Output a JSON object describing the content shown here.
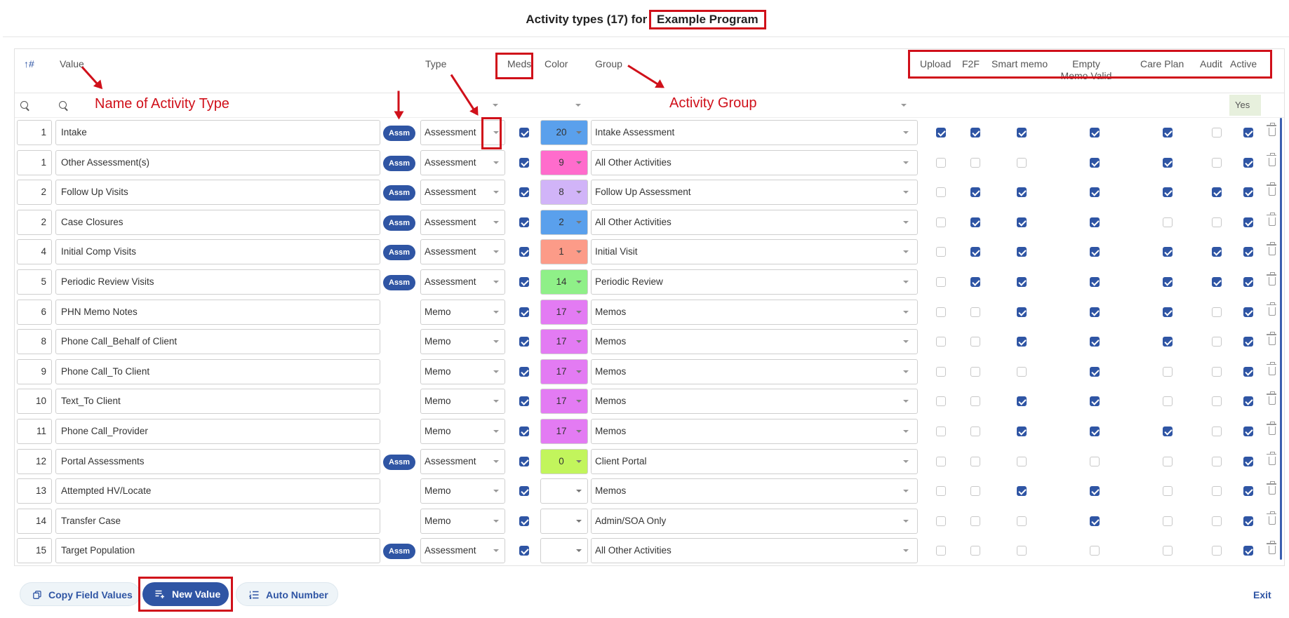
{
  "title": {
    "prefix": "Activity types (17) for",
    "program": "Example Program"
  },
  "columns": {
    "sort": "↑#",
    "value": "Value",
    "type": "Type",
    "meds": "Meds",
    "color": "Color",
    "group": "Group",
    "upload": "Upload",
    "f2f": "F2F",
    "smart_memo": "Smart memo",
    "empty_memo": "Empty Memo Valid",
    "care_plan": "Care Plan",
    "audit": "Audit",
    "active": "Active"
  },
  "filter": {
    "active": "Yes"
  },
  "annotations": {
    "name": "Name of Activity Type",
    "group": "Activity Group"
  },
  "assm_label": "Assm",
  "rows": [
    {
      "num": "1",
      "value": "Intake",
      "assm": true,
      "type": "Assessment",
      "meds": true,
      "color_num": "20",
      "color_hex": "#5aa0ec",
      "group": "Intake Assessment",
      "upload": true,
      "f2f": true,
      "smart": true,
      "empty": true,
      "care": true,
      "audit": false,
      "active": true
    },
    {
      "num": "1",
      "value": "Other Assessment(s)",
      "assm": true,
      "type": "Assessment",
      "meds": true,
      "color_num": "9",
      "color_hex": "#ff6ccc",
      "group": "All Other Activities",
      "upload": false,
      "f2f": false,
      "smart": false,
      "empty": true,
      "care": true,
      "audit": false,
      "active": true
    },
    {
      "num": "2",
      "value": "Follow Up Visits",
      "assm": true,
      "type": "Assessment",
      "meds": true,
      "color_num": "8",
      "color_hex": "#d1b4f8",
      "group": "Follow Up Assessment",
      "upload": false,
      "f2f": true,
      "smart": true,
      "empty": true,
      "care": true,
      "audit": true,
      "active": true
    },
    {
      "num": "2",
      "value": "Case Closures",
      "assm": true,
      "type": "Assessment",
      "meds": true,
      "color_num": "2",
      "color_hex": "#5aa0ec",
      "group": "All Other Activities",
      "upload": false,
      "f2f": true,
      "smart": true,
      "empty": true,
      "care": false,
      "audit": false,
      "active": true
    },
    {
      "num": "4",
      "value": "Initial Comp Visits",
      "assm": true,
      "type": "Assessment",
      "meds": true,
      "color_num": "1",
      "color_hex": "#fc9b88",
      "group": "Initial Visit",
      "upload": false,
      "f2f": true,
      "smart": true,
      "empty": true,
      "care": true,
      "audit": true,
      "active": true
    },
    {
      "num": "5",
      "value": "Periodic Review Visits",
      "assm": true,
      "type": "Assessment",
      "meds": true,
      "color_num": "14",
      "color_hex": "#8ff088",
      "group": "Periodic Review",
      "upload": false,
      "f2f": true,
      "smart": true,
      "empty": true,
      "care": true,
      "audit": true,
      "active": true
    },
    {
      "num": "6",
      "value": "PHN Memo Notes",
      "assm": false,
      "type": "Memo",
      "meds": true,
      "color_num": "17",
      "color_hex": "#e37bf3",
      "group": "Memos",
      "upload": false,
      "f2f": false,
      "smart": true,
      "empty": true,
      "care": true,
      "audit": false,
      "active": true
    },
    {
      "num": "8",
      "value": "Phone Call_Behalf of Client",
      "assm": false,
      "type": "Memo",
      "meds": true,
      "color_num": "17",
      "color_hex": "#e37bf3",
      "group": "Memos",
      "upload": false,
      "f2f": false,
      "smart": true,
      "empty": true,
      "care": true,
      "audit": false,
      "active": true
    },
    {
      "num": "9",
      "value": "Phone Call_To Client",
      "assm": false,
      "type": "Memo",
      "meds": true,
      "color_num": "17",
      "color_hex": "#e37bf3",
      "group": "Memos",
      "upload": false,
      "f2f": false,
      "smart": false,
      "empty": true,
      "care": false,
      "audit": false,
      "active": true
    },
    {
      "num": "10",
      "value": "Text_To Client",
      "assm": false,
      "type": "Memo",
      "meds": true,
      "color_num": "17",
      "color_hex": "#e37bf3",
      "group": "Memos",
      "upload": false,
      "f2f": false,
      "smart": true,
      "empty": true,
      "care": false,
      "audit": false,
      "active": true
    },
    {
      "num": "11",
      "value": "Phone Call_Provider",
      "assm": false,
      "type": "Memo",
      "meds": true,
      "color_num": "17",
      "color_hex": "#e37bf3",
      "group": "Memos",
      "upload": false,
      "f2f": false,
      "smart": true,
      "empty": true,
      "care": true,
      "audit": false,
      "active": true
    },
    {
      "num": "12",
      "value": "Portal Assessments",
      "assm": true,
      "type": "Assessment",
      "meds": true,
      "color_num": "0",
      "color_hex": "#c2f55c",
      "group": "Client Portal",
      "upload": false,
      "f2f": false,
      "smart": false,
      "empty": false,
      "care": false,
      "audit": false,
      "active": true
    },
    {
      "num": "13",
      "value": "Attempted HV/Locate",
      "assm": false,
      "type": "Memo",
      "meds": true,
      "color_num": "",
      "color_hex": "#ffffff",
      "group": "Memos",
      "upload": false,
      "f2f": false,
      "smart": true,
      "empty": true,
      "care": false,
      "audit": false,
      "active": true
    },
    {
      "num": "14",
      "value": "Transfer Case",
      "assm": false,
      "type": "Memo",
      "meds": true,
      "color_num": "",
      "color_hex": "#ffffff",
      "group": "Admin/SOA Only",
      "upload": false,
      "f2f": false,
      "smart": false,
      "empty": true,
      "care": false,
      "audit": false,
      "active": true
    },
    {
      "num": "15",
      "value": "Target Population",
      "assm": true,
      "type": "Assessment",
      "meds": true,
      "color_num": "",
      "color_hex": "#ffffff",
      "group": "All Other Activities",
      "upload": false,
      "f2f": false,
      "smart": false,
      "empty": false,
      "care": false,
      "audit": false,
      "active": true
    }
  ],
  "footer": {
    "copy": "Copy Field Values",
    "new": "New Value",
    "auto": "Auto Number",
    "exit": "Exit"
  }
}
